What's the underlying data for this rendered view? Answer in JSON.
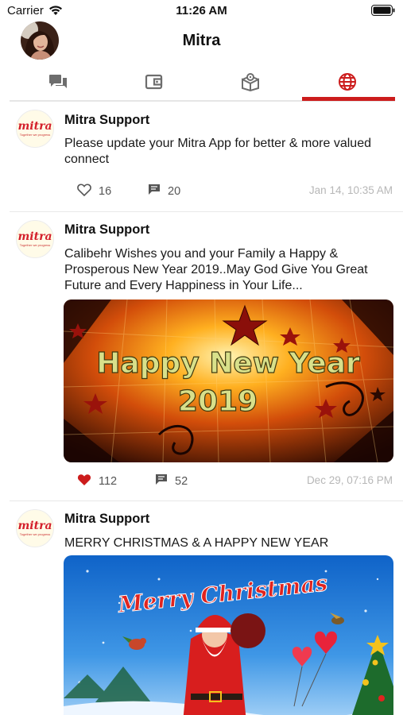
{
  "status_bar": {
    "carrier": "Carrier",
    "time": "11:26 AM",
    "wifi_icon": "wifi-icon",
    "battery_icon": "battery-icon"
  },
  "header": {
    "title": "Mitra",
    "avatar_icon": "profile-avatar"
  },
  "tabs": [
    {
      "icon": "chat-icon",
      "active": false
    },
    {
      "icon": "wallet-icon",
      "active": false
    },
    {
      "icon": "box-icon",
      "active": false
    },
    {
      "icon": "globe-icon",
      "active": true
    }
  ],
  "colors": {
    "accent": "#cc1c1c",
    "icon_gray": "#6d6d6d",
    "timestamp": "#b7b7b7"
  },
  "posts": [
    {
      "author": "Mitra Support",
      "logo_text": "mitra",
      "logo_tagline": "Together we progress",
      "text": "Please update your Mitra App for better & more valued connect",
      "likes": "16",
      "liked": false,
      "comments": "20",
      "time": "Jan 14, 10:35 AM"
    },
    {
      "author": "Mitra Support",
      "logo_text": "mitra",
      "logo_tagline": "Together we progress",
      "text": "Calibehr Wishes you and your Family a Happy & Prosperous New Year 2019..May God Give You Great Future and Every Happiness in Your Life...",
      "image_caption_line1": "Happy New Year",
      "image_caption_line2": "2019",
      "likes": "112",
      "liked": true,
      "comments": "52",
      "time": "Dec 29, 07:16 PM"
    },
    {
      "author": "Mitra Support",
      "logo_text": "mitra",
      "logo_tagline": "Together we progress",
      "text": "MERRY CHRISTMAS & A HAPPY NEW YEAR",
      "image_caption_line1": "Merry Christmas"
    }
  ]
}
